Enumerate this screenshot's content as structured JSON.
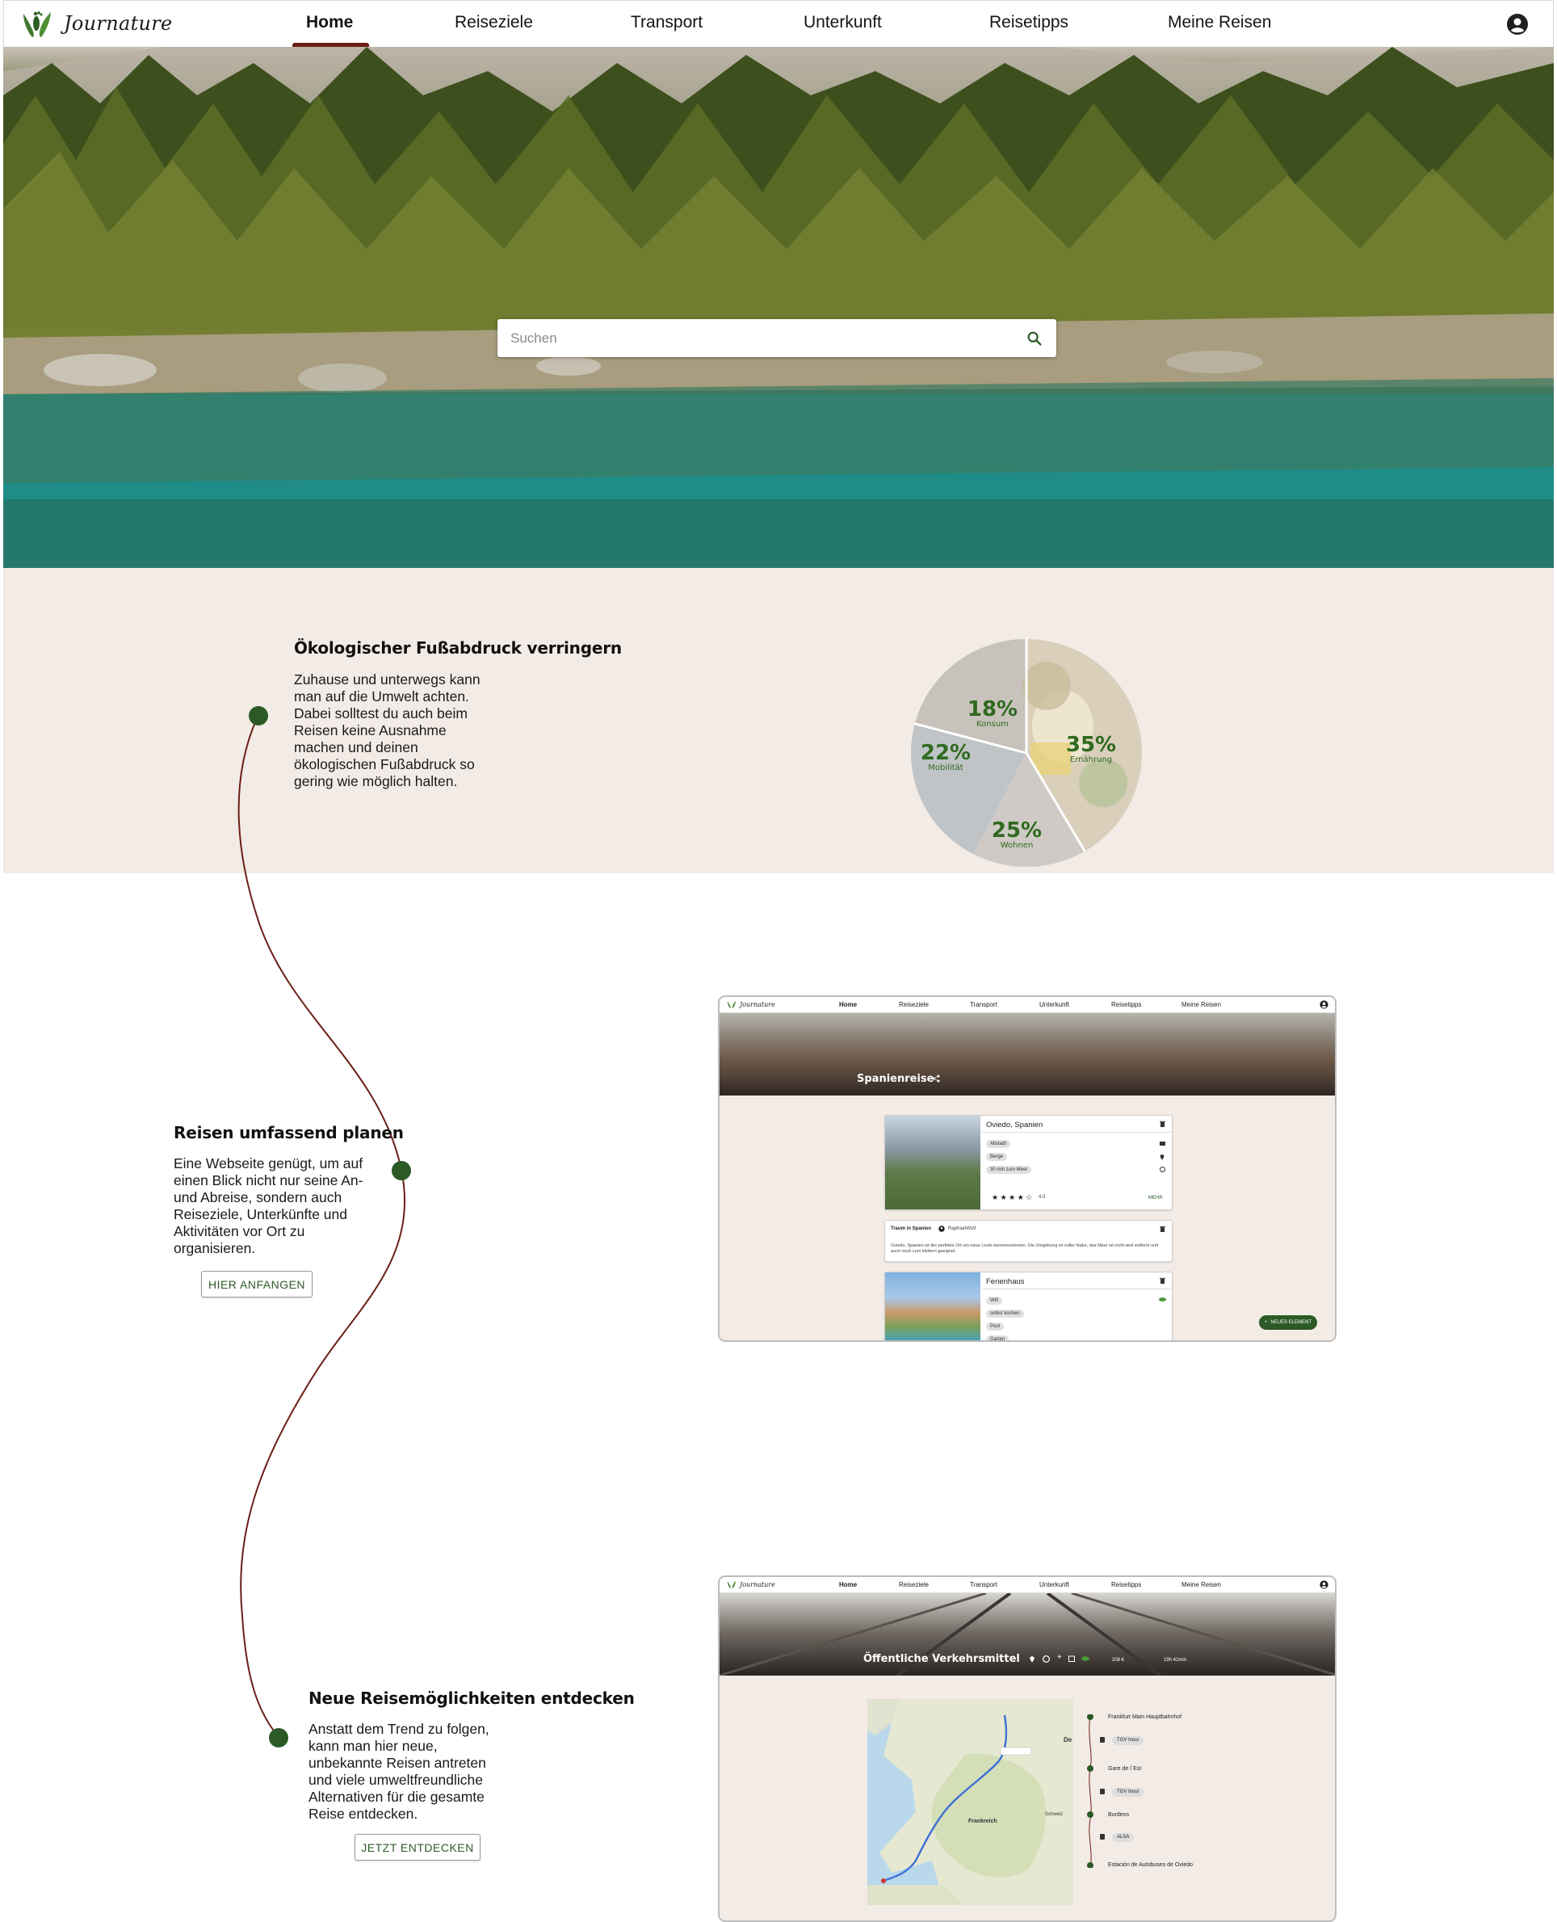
{
  "brand": {
    "name": "Journature"
  },
  "nav": {
    "items": [
      "Home",
      "Reiseziele",
      "Transport",
      "Unterkunft",
      "Reisetipps",
      "Meine Reisen"
    ],
    "active": "Home"
  },
  "search": {
    "placeholder": "Suchen"
  },
  "colors": {
    "accent": "#2b5a26",
    "band": "#f3ebe6",
    "timeline": "#6b1e17"
  },
  "section1": {
    "title": "Ökologischer Fußabdruck verringern",
    "text": "Zuhause und unterwegs kann man auf die Umwelt achten. Dabei solltest du auch beim Reisen keine Ausnahme machen und deinen ökologischen Fußabdruck so gering wie möglich halten.",
    "pie": [
      {
        "pct": "18%",
        "label": "Konsum",
        "value": 18
      },
      {
        "pct": "35%",
        "label": "Ernährung",
        "value": 35
      },
      {
        "pct": "25%",
        "label": "Wohnen",
        "value": 25
      },
      {
        "pct": "22%",
        "label": "Mobilität",
        "value": 22
      }
    ]
  },
  "section2": {
    "title": "Reisen umfassend planen",
    "text": "Eine Webseite genügt, um auf einen Blick nicht nur seine An- und Abreise, sondern auch Reiseziele, Unterkünfte und Aktivitäten vor Ort zu organisieren.",
    "button": "HIER ANFANGEN"
  },
  "section3": {
    "title": "Neue Reisemöglichkeiten entdecken",
    "text": "Anstatt dem Trend zu folgen, kann man hier neue, unbekannte Reisen antreten und viele umweltfreundliche Alternativen für die gesamte Reise entdecken.",
    "button": "JETZT ENTDECKEN"
  },
  "mock1": {
    "hero_title": "Spanienreise",
    "place_card": {
      "title": "Oviedo, Spanien",
      "chips": [
        "Altstadt",
        "Berge",
        "30 min zum Meer"
      ],
      "rating": "4.0",
      "more": "MEHR"
    },
    "note": {
      "title": "Traum in Spanien",
      "author": "RaphaelWolf",
      "text": "Oviedo, Spanien ist der perfekte Ort um neue Leute kennenzulernen. Die Umgebung ist voller Natur, das Meer ist nicht weit entfernt und auch noch zum klettern geeignet."
    },
    "stay_card": {
      "title": "Ferienhaus",
      "chips": [
        "Wifi",
        "selbst kochen",
        "Pool",
        "Garten"
      ]
    },
    "fab": "NEUES ELEMENT"
  },
  "mock2": {
    "hero_title": "Öffentliche Verkehrsmittel",
    "stats": [
      "208 €",
      "19h 42min"
    ],
    "map_labels": [
      "Frankreich",
      "Schweiz",
      "De"
    ],
    "route": [
      {
        "stop": "Frankfurt Main Hauptbahnhof",
        "train": "TGV Inoui"
      },
      {
        "stop": "Gare de l´Est",
        "train": "TGV Inoui"
      },
      {
        "stop": "Burdeos",
        "train": "ALSA"
      },
      {
        "stop": "Estación de Autobuses de Oviedo",
        "train": ""
      }
    ]
  }
}
